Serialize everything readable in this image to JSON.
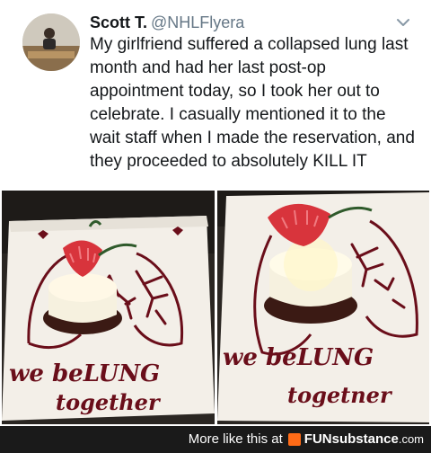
{
  "tweet": {
    "author_name": "Scott T.",
    "author_handle": "@NHLFlyera",
    "text": "My girlfriend suffered a collapsed lung last month and had her last post-op appointment today, so I took her out to celebrate. I casually mentioned it to the wait staff when I made the reservation, and they proceeded to absolutely KILL IT"
  },
  "photos": [
    {
      "dessert_message_line1": "we beLUNG",
      "dessert_message_line2": "together"
    },
    {
      "dessert_message_line1": "we beLUNG",
      "dessert_message_line2": "togetner"
    }
  ],
  "footer": {
    "prefix": "More like this at",
    "logo_fun": "FUN",
    "logo_substance": "substance",
    "logo_com": ".com"
  },
  "colors": {
    "text": "#14171a",
    "handle": "#657786",
    "sauce": "#6a0e1a",
    "strawberry": "#d8343c",
    "footer_bg": "#1a1a1a",
    "logo_accent": "#ff6b17"
  }
}
